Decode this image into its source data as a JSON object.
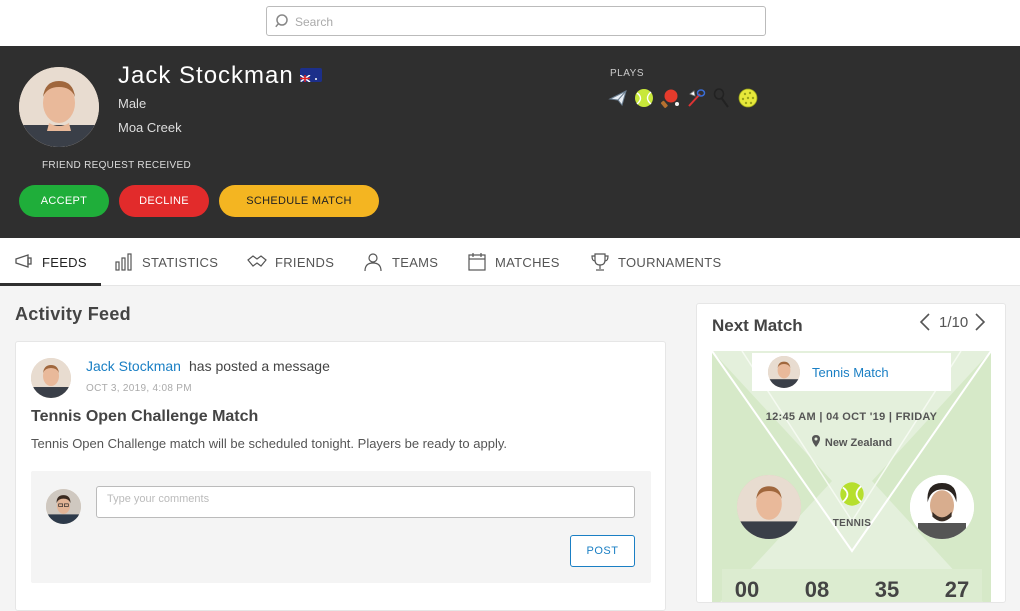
{
  "search": {
    "placeholder": "Search"
  },
  "profile": {
    "name": "Jack Stockman",
    "gender": "Male",
    "location": "Moa Creek",
    "friend_request_text": "FRIEND REQUEST RECEIVED",
    "accept_label": "ACCEPT",
    "decline_label": "DECLINE",
    "schedule_label": "SCHEDULE MATCH",
    "plays_label": "PLAYS",
    "sports": [
      "paper-plane-icon",
      "tennis-ball-icon",
      "ping-pong-icon",
      "badminton-icon",
      "squash-racket-icon",
      "pickleball-icon"
    ],
    "colors": {
      "accept": "#1fae3a",
      "decline": "#e22b2b",
      "schedule": "#f4b521"
    }
  },
  "tabs": [
    {
      "label": "FEEDS",
      "icon": "feed-icon"
    },
    {
      "label": "STATISTICS",
      "icon": "statistics-icon"
    },
    {
      "label": "FRIENDS",
      "icon": "handshake-icon"
    },
    {
      "label": "TEAMS",
      "icon": "team-icon"
    },
    {
      "label": "MATCHES",
      "icon": "calendar-icon"
    },
    {
      "label": "TOURNAMENTS",
      "icon": "trophy-icon"
    }
  ],
  "feed": {
    "title": "Activity Feed",
    "post": {
      "author": "Jack Stockman",
      "action": "has posted a message",
      "date": "OCT 3, 2019, 4:08 PM",
      "title": "Tennis Open Challenge Match",
      "body": "Tennis Open Challenge match will be scheduled tonight. Players be ready to apply.",
      "comment_placeholder": "Type your comments",
      "post_label": "POST"
    }
  },
  "next_match": {
    "title": "Next Match",
    "pager": "1/10",
    "match_title": "Tennis Match",
    "datetime": "12:45 AM | 04 OCT '19 | FRIDAY",
    "location": "New Zealand",
    "sport": "TENNIS",
    "countdown": [
      "00",
      "08",
      "35",
      "27"
    ]
  }
}
